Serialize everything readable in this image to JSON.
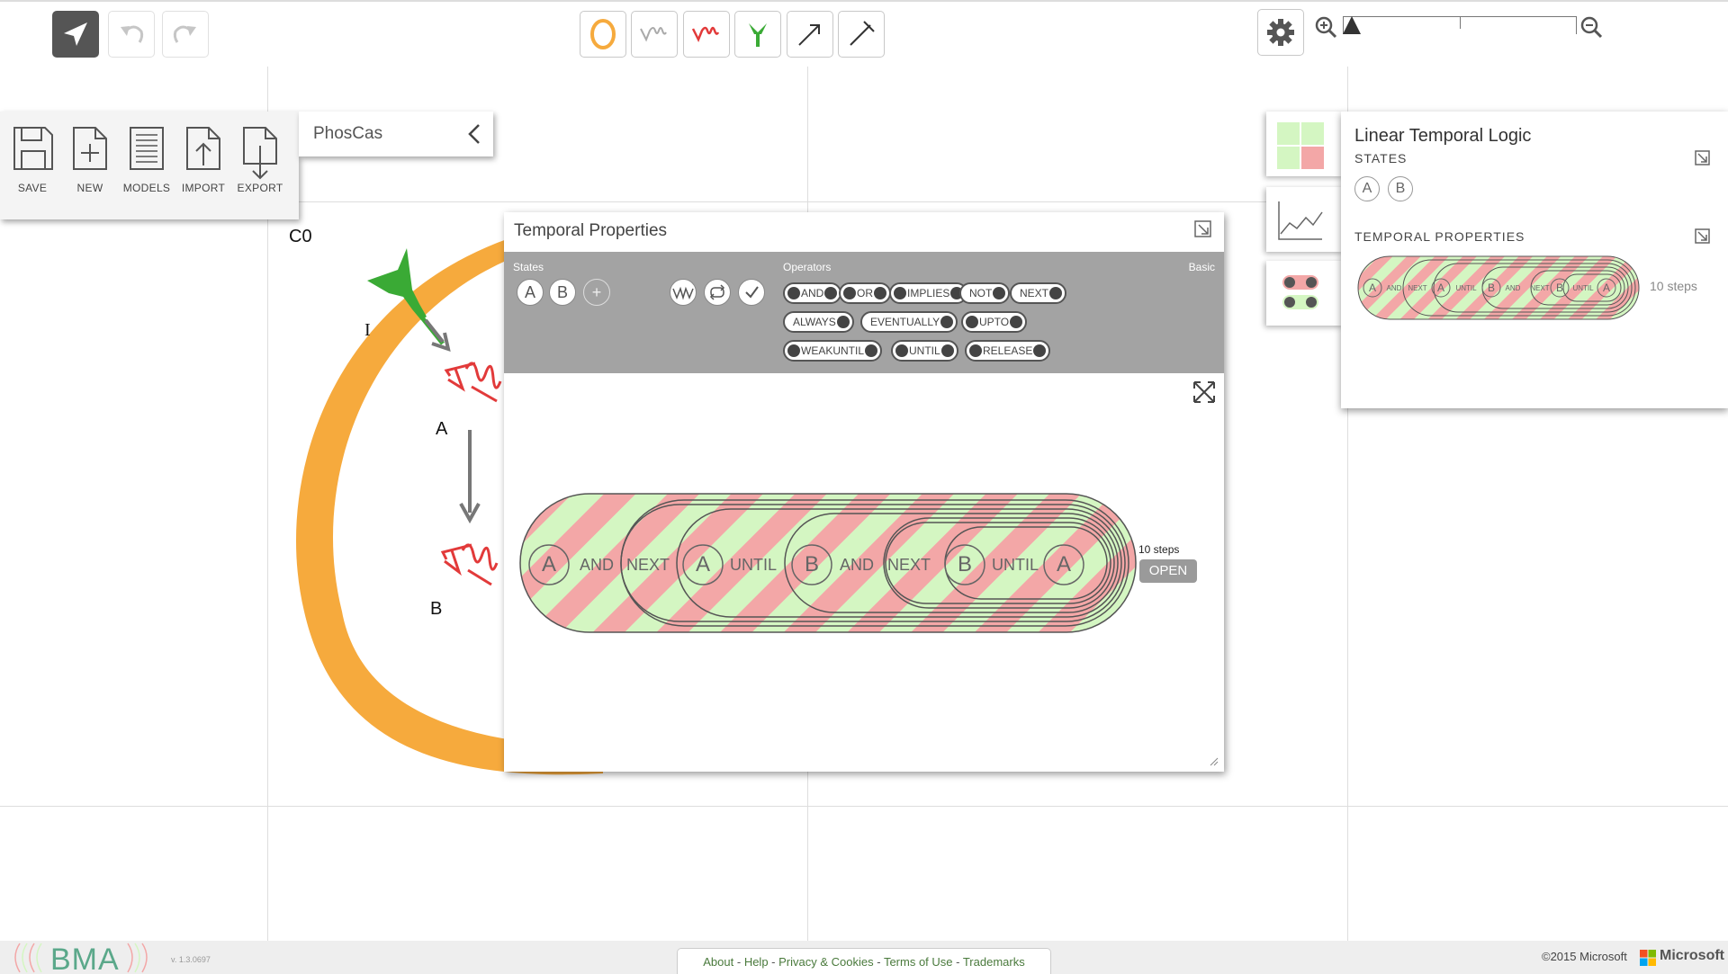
{
  "toolbar": {
    "left_buttons": [
      "pointer-tool",
      "undo",
      "redo"
    ],
    "center_buttons": [
      "container",
      "variable",
      "constant",
      "receptor",
      "activator",
      "inhibitor"
    ]
  },
  "file_menu": {
    "items": [
      {
        "label": "SAVE",
        "icon": "save-icon"
      },
      {
        "label": "NEW",
        "icon": "new-icon"
      },
      {
        "label": "MODELS",
        "icon": "models-icon"
      },
      {
        "label": "IMPORT",
        "icon": "import-icon"
      },
      {
        "label": "EXPORT",
        "icon": "export-icon"
      }
    ],
    "model_name": "PhosCas"
  },
  "canvas": {
    "container_label": "C0",
    "receptor_label": "I",
    "var_a_label": "A",
    "var_b_label": "B"
  },
  "temporal_window": {
    "title": "Temporal Properties",
    "states_label": "States",
    "operators_label": "Operators",
    "mode_label": "Basic",
    "states": [
      "A",
      "B"
    ],
    "operators": [
      "AND",
      "OR",
      "IMPLIES",
      "NOT",
      "NEXT",
      "ALWAYS",
      "EVENTUALLY",
      "UPTO",
      "WEAKUNTIL",
      "UNTIL",
      "RELEASE"
    ],
    "formula": [
      "A",
      "AND",
      "NEXT",
      "A",
      "UNTIL",
      "B",
      "AND",
      "NEXT",
      "B",
      "UNTIL",
      "A"
    ],
    "steps": "10 steps",
    "open_label": "OPEN"
  },
  "right_panel": {
    "title": "Linear Temporal Logic",
    "states_heading": "STATES",
    "states": [
      "A",
      "B"
    ],
    "props_heading": "TEMPORAL PROPERTIES",
    "steps": "10 steps"
  },
  "footer": {
    "brand": "BMA",
    "version": "v. 1.3.0697",
    "links": [
      "About",
      "Help",
      "Privacy & Cookies",
      "Terms of Use",
      "Trademarks"
    ],
    "copyright": "©2015 Microsoft",
    "ms": "Microsoft"
  },
  "colors": {
    "container_orange": "#f6aa3d",
    "receptor_green": "#3aaa35",
    "variable_red": "#e23a3a",
    "stripe_green": "#d4f6c2",
    "stripe_red": "#f3a7a7"
  }
}
